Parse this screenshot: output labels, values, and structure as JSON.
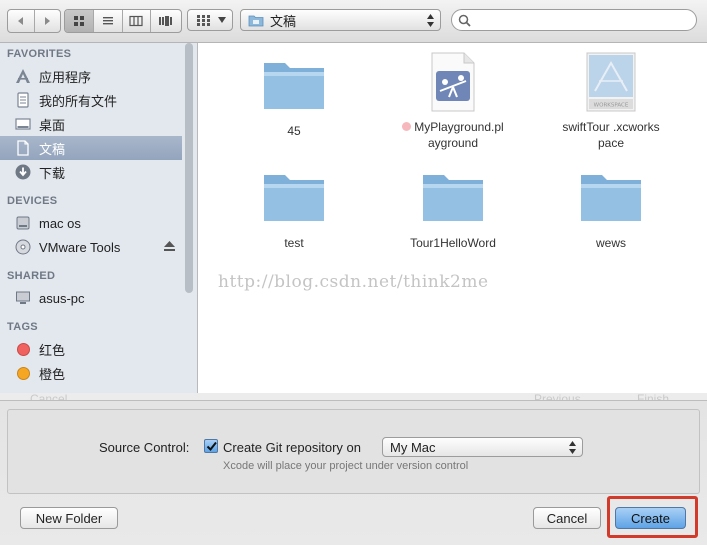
{
  "toolbar": {
    "back_icon": "chevron-left-icon",
    "forward_icon": "chevron-right-icon",
    "view_modes": [
      "icon-view",
      "list-view",
      "column-view",
      "cover-flow-view"
    ],
    "arrange_icon": "grid-icon",
    "location_label": "文稿",
    "search_placeholder": ""
  },
  "sidebar": {
    "favorites_header": "FAVORITES",
    "favorites": [
      {
        "label": "应用程序",
        "icon": "apps-icon"
      },
      {
        "label": "我的所有文件",
        "icon": "all-files-icon"
      },
      {
        "label": "桌面",
        "icon": "desktop-icon"
      },
      {
        "label": "文稿",
        "icon": "documents-icon",
        "selected": true
      },
      {
        "label": "下载",
        "icon": "download-icon"
      }
    ],
    "devices_header": "DEVICES",
    "devices": [
      {
        "label": "mac os",
        "icon": "disk-icon"
      },
      {
        "label": "VMware Tools",
        "icon": "cd-icon",
        "eject": true
      }
    ],
    "shared_header": "SHARED",
    "shared": [
      {
        "label": "asus-pc",
        "icon": "computer-icon"
      }
    ],
    "tags_header": "TAGS",
    "tags": [
      {
        "label": "红色",
        "color": "#f0625f"
      },
      {
        "label": "橙色",
        "color": "#f5a623"
      }
    ]
  },
  "files": [
    {
      "name": "45",
      "type": "folder"
    },
    {
      "name": "MyPlayground.playground",
      "line1": "MyPlayground.pl",
      "line2": "ayground",
      "type": "playground",
      "tag_color": "#f7b8bd"
    },
    {
      "name": "swiftTour.xcworkspace",
      "line1": "swiftTour .xcworks",
      "line2": "pace",
      "type": "workspace",
      "badge": "WORKSPACE"
    },
    {
      "name": "test",
      "type": "folder"
    },
    {
      "name": "Tour1HelloWord",
      "type": "folder"
    },
    {
      "name": "wews",
      "type": "folder"
    }
  ],
  "watermark": "http://blog.csdn.net/think2me",
  "ghost_buttons": {
    "cancel": "Cancel",
    "previous": "Previous",
    "finish": "Finish"
  },
  "source_control": {
    "label": "Source Control:",
    "checkbox_label": "Create Git repository on",
    "checked": true,
    "location": "My Mac",
    "note": "Xcode will place your project under version control"
  },
  "buttons": {
    "new_folder": "New Folder",
    "cancel": "Cancel",
    "create": "Create"
  },
  "colors": {
    "sidebar_bg": "#e3e8ee",
    "selection": "#a0b0c6",
    "primary_button": "#5ea3e6",
    "highlight": "#d23a2a",
    "folder": "#8cb8dc"
  }
}
